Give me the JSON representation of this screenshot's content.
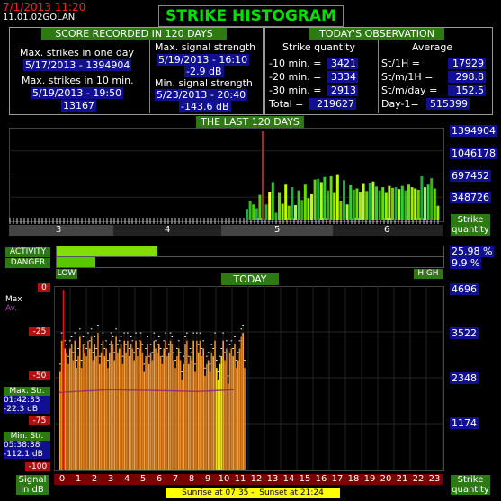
{
  "header": {
    "datetime": "7/1/2013 11:20",
    "station": "11.01.02GOLAN",
    "title": "STRIKE HISTOGRAM"
  },
  "score": {
    "heading": "SCORE RECORDED IN 120 DAYS",
    "max_one_day_label": "Max. strikes in one day",
    "max_one_day_value": "5/17/2013 - 1394904",
    "max_10min_label": "Max. strikes in 10 min.",
    "max_10min_date": "5/19/2013 - 19:50",
    "max_10min_value": "13167",
    "max_signal_label": "Max. signal strength",
    "max_signal_date": "5/19/2013 - 16:10",
    "max_signal_value": "-2.9 dB",
    "min_signal_label": "Min. signal strength",
    "min_signal_date": "5/23/2013 - 20:40",
    "min_signal_value": "-143.6 dB"
  },
  "today_obs": {
    "heading": "TODAY'S OBSERVATION",
    "quantity_heading": "Strike quantity",
    "average_heading": "Average",
    "q10_label": "-10 min. =",
    "q10_value": "3421",
    "q20_label": "-20 min. =",
    "q20_value": "3334",
    "q30_label": "-30 min. =",
    "q30_value": "2913",
    "total_label": "Total =",
    "total_value": "219627",
    "st1h_label": "St/1H =",
    "st1h_value": "17929",
    "stm1h_label": "St/m/1H =",
    "stm1h_value": "298.8",
    "stmday_label": "St/m/day =",
    "stmday_value": "152.5",
    "day1_label": "Day-1=",
    "day1_value": "515399"
  },
  "last120": {
    "heading": "THE LAST 120 DAYS",
    "y_ticks": [
      "1394904",
      "1046178",
      "697452",
      "348726"
    ],
    "x_ticks": [
      "3",
      "4",
      "5",
      "6"
    ],
    "quantity_label_1": "Strike",
    "quantity_label_2": "quantity"
  },
  "activity": {
    "activity_label": "ACTIVITY",
    "danger_label": "DANGER",
    "activity_value": "25.98 %",
    "danger_value": "9.9 %",
    "activity_fraction": 0.2598,
    "danger_fraction": 0.099,
    "low_label": "LOW",
    "high_label": "HIGH"
  },
  "today_chart": {
    "heading": "TODAY",
    "max_label": "Max",
    "av_label": "Av.",
    "left_ticks": [
      "0",
      "-25",
      "-50",
      "-75",
      "-100"
    ],
    "right_ticks": [
      "4696",
      "3522",
      "2348",
      "1174"
    ],
    "x_ticks": [
      "0",
      "1",
      "2",
      "3",
      "4",
      "5",
      "6",
      "7",
      "8",
      "9",
      "10",
      "11",
      "12",
      "13",
      "14",
      "15",
      "16",
      "17",
      "18",
      "19",
      "20",
      "21",
      "22",
      "23"
    ],
    "max_str_label": "Max. Str.",
    "max_str_time": "01:42:33",
    "max_str_value": "-22.3 dB",
    "min_str_label": "Min. Str.",
    "min_str_time": "05:38:38",
    "min_str_value": "-112.1 dB",
    "signal_label_1": "Signal",
    "signal_label_2": "in dB",
    "quantity_label_1": "Strike",
    "quantity_label_2": "quantity",
    "sunrise_label": "Sunrise at 07:35",
    "sunset_label": "Sunset at 21:24"
  },
  "colors": {
    "title_green": "#00e000",
    "header_red": "#ff2020",
    "navy": "#101090",
    "band_green": "#2e7a12",
    "activity_bar": "#7fe000",
    "danger_bar": "#5ac800",
    "peak_red": "#e01010",
    "today_orange": "#e8922a",
    "sun_yellow": "#ffff00"
  },
  "chart_data": [
    {
      "type": "bar",
      "title": "THE LAST 120 DAYS",
      "ylabel": "Strike quantity",
      "ylim": [
        0,
        1394904
      ],
      "y_ticks": [
        348726,
        697452,
        1046178,
        1394904
      ],
      "x_ticks": [
        "3",
        "4",
        "5",
        "6"
      ],
      "values": [
        180000,
        310000,
        250000,
        190000,
        400000,
        1394904,
        250000,
        440000,
        600000,
        120000,
        430000,
        260000,
        560000,
        230000,
        520000,
        240000,
        470000,
        320000,
        560000,
        350000,
        410000,
        640000,
        650000,
        600000,
        680000,
        470000,
        690000,
        430000,
        710000,
        300000,
        630000,
        250000,
        550000,
        480000,
        500000,
        440000,
        570000,
        460000,
        580000,
        610000,
        530000,
        470000,
        520000,
        430000,
        540000,
        510000,
        520000,
        490000,
        540000,
        470000,
        560000,
        520000,
        500000,
        480000,
        690000,
        520000,
        560000,
        660000,
        500000,
        230000
      ]
    },
    {
      "type": "bar",
      "title": "TODAY",
      "ylabel": "Strike quantity",
      "ylim": [
        0,
        4696
      ],
      "y_ticks": [
        1174,
        2348,
        3522,
        4696
      ],
      "x_ticks": [
        "0",
        "1",
        "2",
        "3",
        "4",
        "5",
        "6",
        "7",
        "8",
        "9",
        "10",
        "11",
        "12",
        "13",
        "14",
        "15",
        "16",
        "17",
        "18",
        "19",
        "20",
        "21",
        "22",
        "23"
      ],
      "values": [
        2500,
        3300,
        4600,
        3100,
        3000,
        2700,
        3100,
        3200,
        2800,
        3300,
        2600,
        2900,
        3400,
        2600,
        3200,
        3000,
        2900,
        3300,
        3100,
        3400,
        2800,
        3200,
        2900,
        3500,
        2700,
        3000,
        3300,
        2900,
        3100,
        2600,
        3000,
        3300,
        3200,
        2800,
        3400,
        3000,
        3100,
        3200,
        2700,
        3300,
        3000,
        3300,
        2900,
        3200,
        3100,
        2800,
        3300,
        2900,
        3100,
        3300,
        3000,
        2500,
        2900,
        3200,
        2700,
        3000,
        2800,
        3300,
        3100,
        3000,
        3200,
        2900,
        2700,
        3100,
        3300,
        2900,
        3000,
        3300,
        3200,
        2800,
        2600,
        2900,
        3100,
        2800,
        2300,
        2700,
        3200,
        3300,
        2700,
        2900,
        2800,
        3300,
        2500,
        3300,
        3000,
        3300,
        2900,
        3100,
        2400,
        2700,
        2800,
        2500,
        3000,
        2900,
        3300,
        2600,
        2300,
        2700,
        2900,
        3300,
        2800,
        3100,
        2200,
        3000,
        3100,
        2900,
        3200,
        2600,
        2800,
        3100,
        3400,
        3500,
        2600
      ],
      "signal_max_db": [
        -22.3
      ],
      "signal_avg_db": [
        -57
      ]
    }
  ]
}
